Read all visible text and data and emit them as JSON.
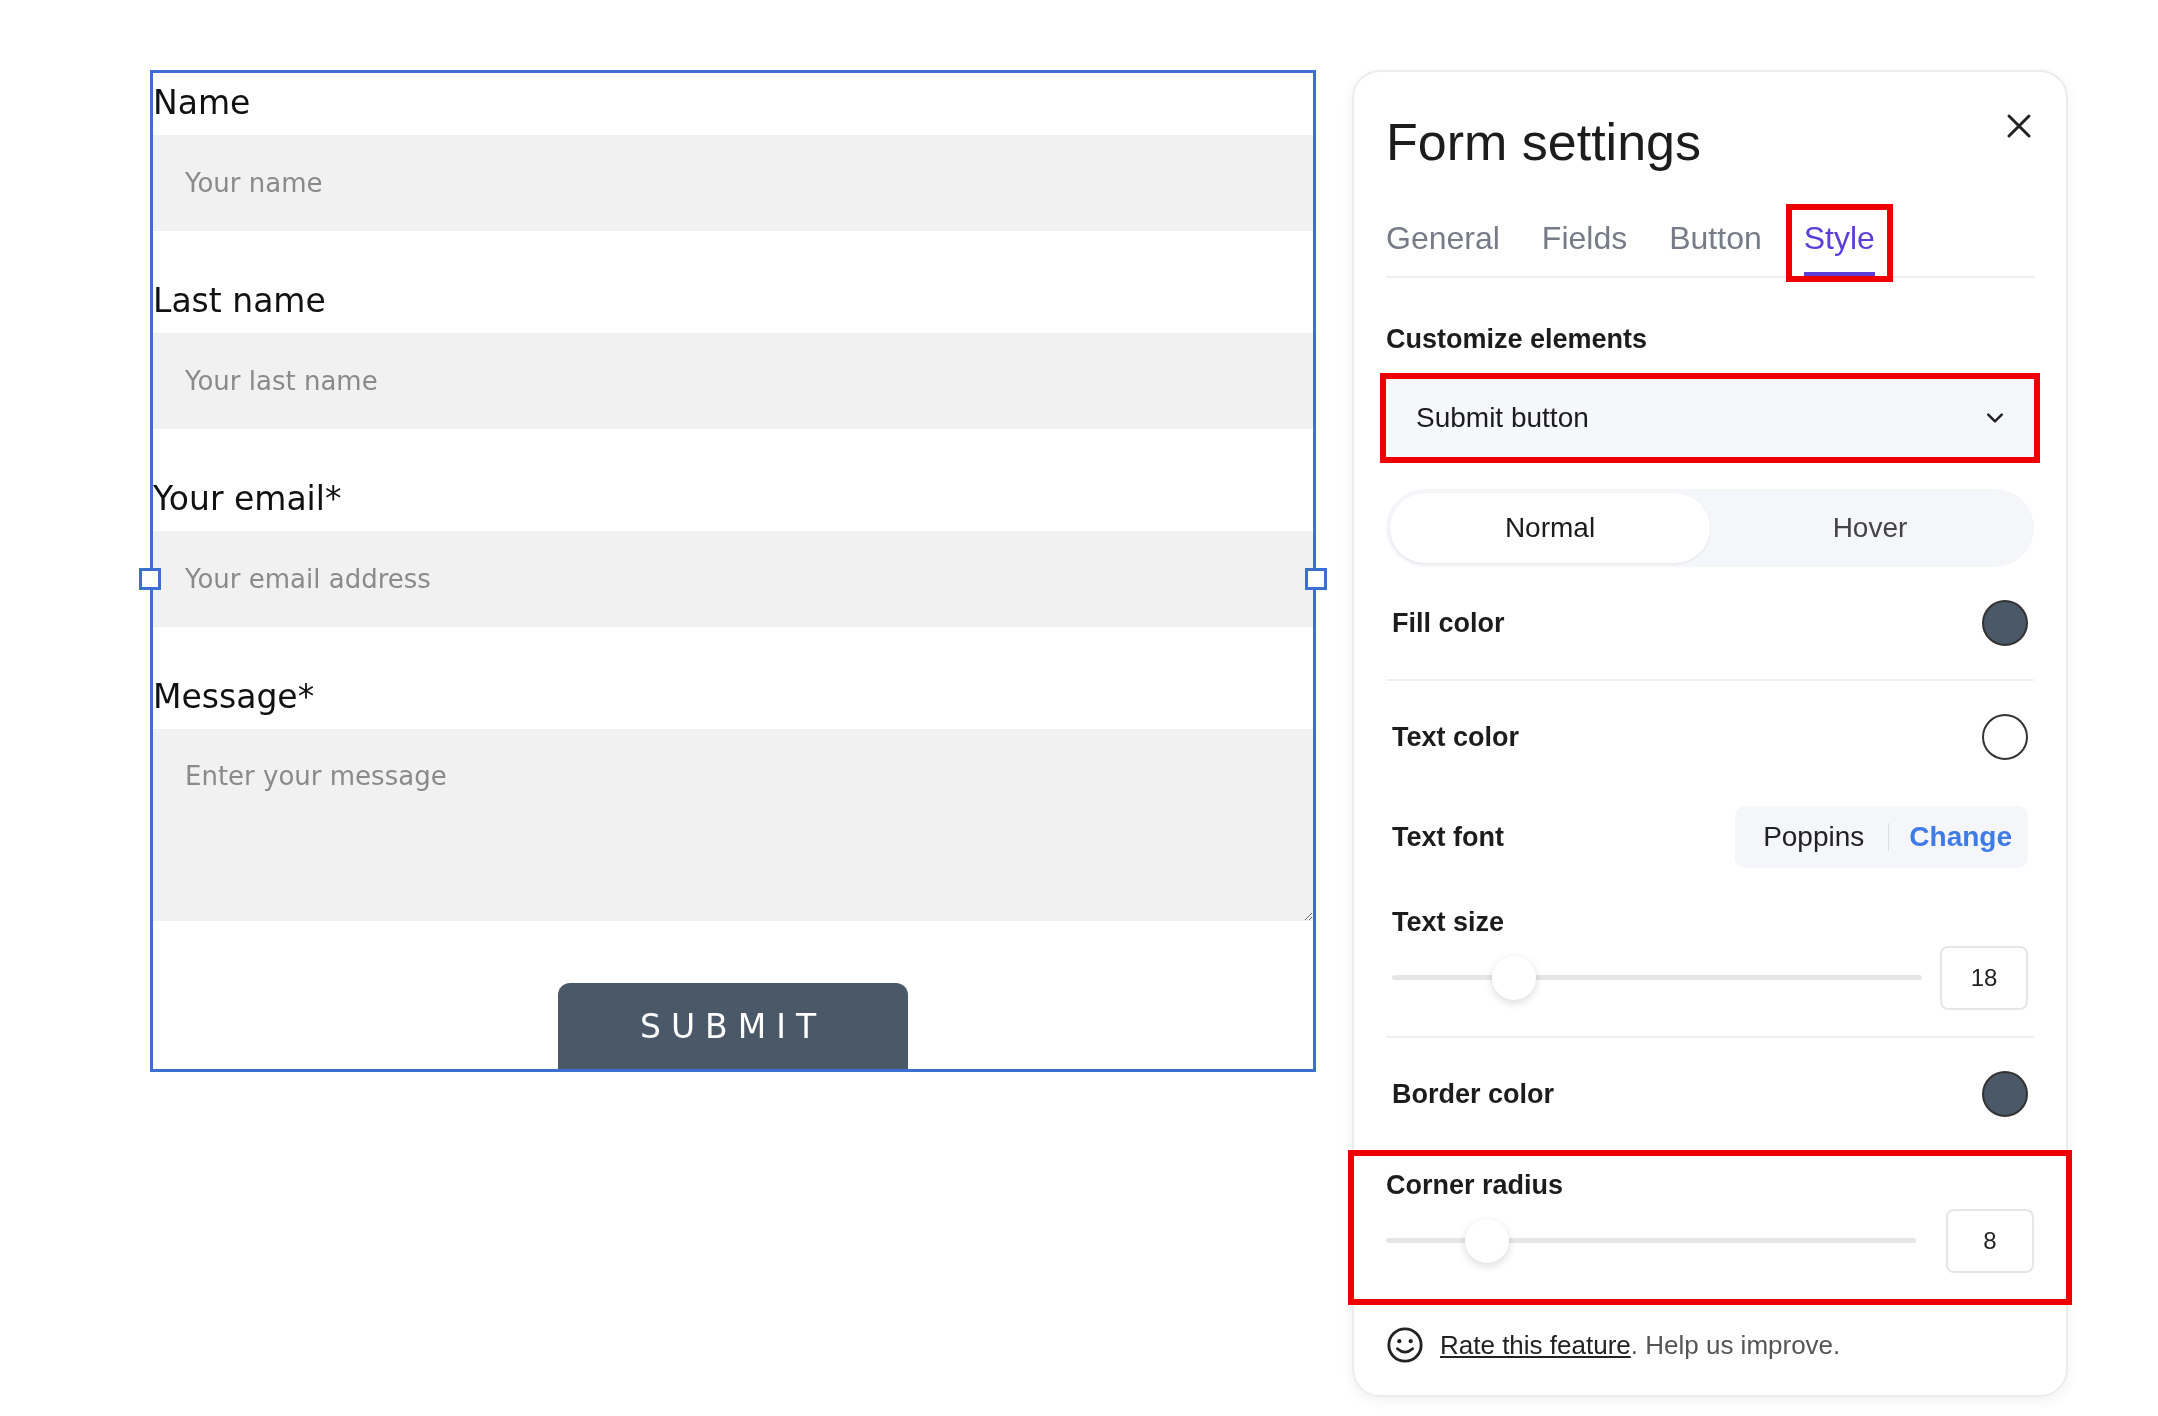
{
  "form": {
    "fields": [
      {
        "kind": "input",
        "label": "Name",
        "placeholder": "Your name"
      },
      {
        "kind": "input",
        "label": "Last name",
        "placeholder": "Your last name"
      },
      {
        "kind": "input",
        "label": "Your email*",
        "placeholder": "Your email address",
        "selected": true
      },
      {
        "kind": "textarea",
        "label": "Message*",
        "placeholder": "Enter your message"
      }
    ],
    "submit": "SUBMIT"
  },
  "panel": {
    "title": "Form settings",
    "tabs": [
      {
        "label": "General",
        "selected": false,
        "highlighted": false
      },
      {
        "label": "Fields",
        "selected": false,
        "highlighted": false
      },
      {
        "label": "Button",
        "selected": false,
        "highlighted": false
      },
      {
        "label": "Style",
        "selected": true,
        "highlighted": true
      }
    ],
    "customize_label": "Customize elements",
    "element_dropdown": {
      "value": "Submit button",
      "highlighted": true
    },
    "states": [
      {
        "label": "Normal",
        "selected": true
      },
      {
        "label": "Hover",
        "selected": false
      }
    ],
    "settings": [
      {
        "kind": "color",
        "label": "Fill color",
        "color": "#4a5868",
        "divider": true,
        "highlighted": false
      },
      {
        "kind": "color",
        "label": "Text color",
        "color": "#ffffff",
        "divider": false,
        "highlighted": false
      },
      {
        "kind": "font",
        "label": "Text font",
        "font": "Poppins",
        "action": "Change",
        "divider": false,
        "highlighted": false
      },
      {
        "kind": "slider",
        "label": "Text size",
        "level": 0.23,
        "value": "18",
        "divider": true,
        "highlighted": false
      },
      {
        "kind": "color",
        "label": "Border color",
        "color": "#4a5868",
        "divider": false,
        "highlighted": false
      },
      {
        "kind": "slider",
        "label": "Corner radius",
        "level": 0.19,
        "value": "8",
        "divider": false,
        "highlighted": true
      }
    ],
    "footer": {
      "link": "Rate this feature",
      "text": ". Help us improve."
    }
  }
}
